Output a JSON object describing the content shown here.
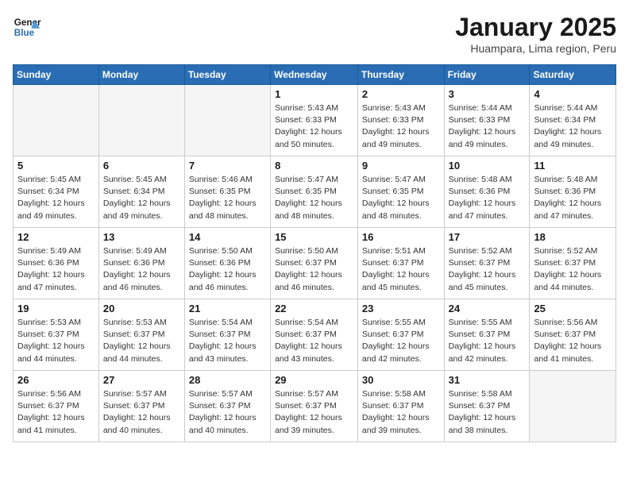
{
  "header": {
    "logo_line1": "General",
    "logo_line2": "Blue",
    "month": "January 2025",
    "location": "Huampara, Lima region, Peru"
  },
  "days_of_week": [
    "Sunday",
    "Monday",
    "Tuesday",
    "Wednesday",
    "Thursday",
    "Friday",
    "Saturday"
  ],
  "weeks": [
    [
      {
        "day": "",
        "info": ""
      },
      {
        "day": "",
        "info": ""
      },
      {
        "day": "",
        "info": ""
      },
      {
        "day": "1",
        "info": "Sunrise: 5:43 AM\nSunset: 6:33 PM\nDaylight: 12 hours\nand 50 minutes."
      },
      {
        "day": "2",
        "info": "Sunrise: 5:43 AM\nSunset: 6:33 PM\nDaylight: 12 hours\nand 49 minutes."
      },
      {
        "day": "3",
        "info": "Sunrise: 5:44 AM\nSunset: 6:33 PM\nDaylight: 12 hours\nand 49 minutes."
      },
      {
        "day": "4",
        "info": "Sunrise: 5:44 AM\nSunset: 6:34 PM\nDaylight: 12 hours\nand 49 minutes."
      }
    ],
    [
      {
        "day": "5",
        "info": "Sunrise: 5:45 AM\nSunset: 6:34 PM\nDaylight: 12 hours\nand 49 minutes."
      },
      {
        "day": "6",
        "info": "Sunrise: 5:45 AM\nSunset: 6:34 PM\nDaylight: 12 hours\nand 49 minutes."
      },
      {
        "day": "7",
        "info": "Sunrise: 5:46 AM\nSunset: 6:35 PM\nDaylight: 12 hours\nand 48 minutes."
      },
      {
        "day": "8",
        "info": "Sunrise: 5:47 AM\nSunset: 6:35 PM\nDaylight: 12 hours\nand 48 minutes."
      },
      {
        "day": "9",
        "info": "Sunrise: 5:47 AM\nSunset: 6:35 PM\nDaylight: 12 hours\nand 48 minutes."
      },
      {
        "day": "10",
        "info": "Sunrise: 5:48 AM\nSunset: 6:36 PM\nDaylight: 12 hours\nand 47 minutes."
      },
      {
        "day": "11",
        "info": "Sunrise: 5:48 AM\nSunset: 6:36 PM\nDaylight: 12 hours\nand 47 minutes."
      }
    ],
    [
      {
        "day": "12",
        "info": "Sunrise: 5:49 AM\nSunset: 6:36 PM\nDaylight: 12 hours\nand 47 minutes."
      },
      {
        "day": "13",
        "info": "Sunrise: 5:49 AM\nSunset: 6:36 PM\nDaylight: 12 hours\nand 46 minutes."
      },
      {
        "day": "14",
        "info": "Sunrise: 5:50 AM\nSunset: 6:36 PM\nDaylight: 12 hours\nand 46 minutes."
      },
      {
        "day": "15",
        "info": "Sunrise: 5:50 AM\nSunset: 6:37 PM\nDaylight: 12 hours\nand 46 minutes."
      },
      {
        "day": "16",
        "info": "Sunrise: 5:51 AM\nSunset: 6:37 PM\nDaylight: 12 hours\nand 45 minutes."
      },
      {
        "day": "17",
        "info": "Sunrise: 5:52 AM\nSunset: 6:37 PM\nDaylight: 12 hours\nand 45 minutes."
      },
      {
        "day": "18",
        "info": "Sunrise: 5:52 AM\nSunset: 6:37 PM\nDaylight: 12 hours\nand 44 minutes."
      }
    ],
    [
      {
        "day": "19",
        "info": "Sunrise: 5:53 AM\nSunset: 6:37 PM\nDaylight: 12 hours\nand 44 minutes."
      },
      {
        "day": "20",
        "info": "Sunrise: 5:53 AM\nSunset: 6:37 PM\nDaylight: 12 hours\nand 44 minutes."
      },
      {
        "day": "21",
        "info": "Sunrise: 5:54 AM\nSunset: 6:37 PM\nDaylight: 12 hours\nand 43 minutes."
      },
      {
        "day": "22",
        "info": "Sunrise: 5:54 AM\nSunset: 6:37 PM\nDaylight: 12 hours\nand 43 minutes."
      },
      {
        "day": "23",
        "info": "Sunrise: 5:55 AM\nSunset: 6:37 PM\nDaylight: 12 hours\nand 42 minutes."
      },
      {
        "day": "24",
        "info": "Sunrise: 5:55 AM\nSunset: 6:37 PM\nDaylight: 12 hours\nand 42 minutes."
      },
      {
        "day": "25",
        "info": "Sunrise: 5:56 AM\nSunset: 6:37 PM\nDaylight: 12 hours\nand 41 minutes."
      }
    ],
    [
      {
        "day": "26",
        "info": "Sunrise: 5:56 AM\nSunset: 6:37 PM\nDaylight: 12 hours\nand 41 minutes."
      },
      {
        "day": "27",
        "info": "Sunrise: 5:57 AM\nSunset: 6:37 PM\nDaylight: 12 hours\nand 40 minutes."
      },
      {
        "day": "28",
        "info": "Sunrise: 5:57 AM\nSunset: 6:37 PM\nDaylight: 12 hours\nand 40 minutes."
      },
      {
        "day": "29",
        "info": "Sunrise: 5:57 AM\nSunset: 6:37 PM\nDaylight: 12 hours\nand 39 minutes."
      },
      {
        "day": "30",
        "info": "Sunrise: 5:58 AM\nSunset: 6:37 PM\nDaylight: 12 hours\nand 39 minutes."
      },
      {
        "day": "31",
        "info": "Sunrise: 5:58 AM\nSunset: 6:37 PM\nDaylight: 12 hours\nand 38 minutes."
      },
      {
        "day": "",
        "info": ""
      }
    ]
  ]
}
